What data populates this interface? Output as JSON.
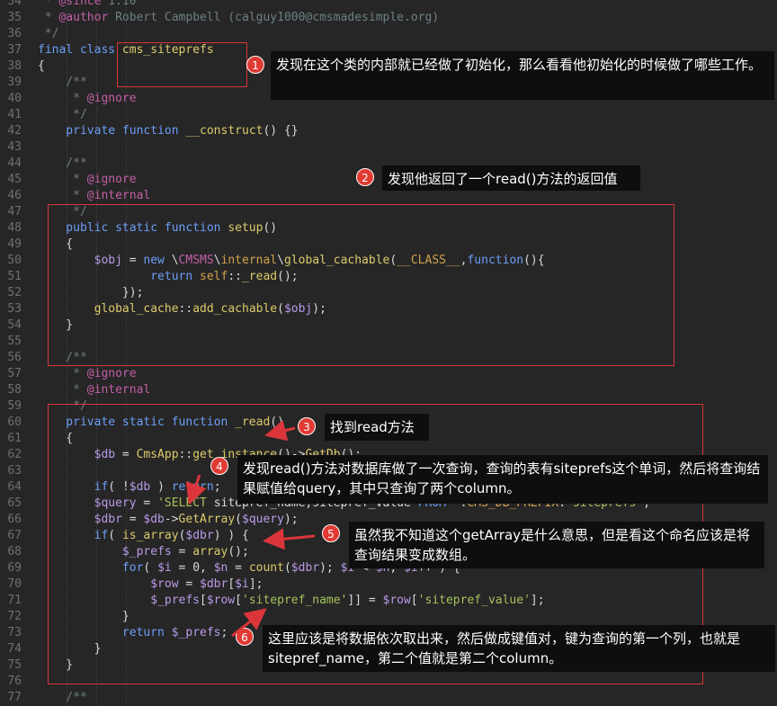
{
  "colors": {
    "annotation_red": "#d9353a",
    "badge_red": "#e03b33",
    "callout_bg": "#0e0e0e",
    "editor_bg": "#262626"
  },
  "code_lines": [
    {
      "n": "34",
      "t": [
        [
          "cm",
          " * "
        ],
        [
          "cmt",
          "@since"
        ],
        [
          "cm",
          " 1.10"
        ]
      ]
    },
    {
      "n": "35",
      "t": [
        [
          "cm",
          " * "
        ],
        [
          "cmt",
          "@author"
        ],
        [
          "cm",
          " Robert Campbell (calguy1000@cmsmadesimple.org)"
        ]
      ]
    },
    {
      "n": "36",
      "t": [
        [
          "cm",
          " */"
        ]
      ]
    },
    {
      "n": "37",
      "t": [
        [
          "kw",
          "final class "
        ],
        [
          "fn",
          "cms_siteprefs"
        ]
      ]
    },
    {
      "n": "38",
      "t": [
        [
          "pun",
          "{"
        ]
      ]
    },
    {
      "n": "39",
      "t": [
        [
          "cm",
          "    /**"
        ]
      ]
    },
    {
      "n": "40",
      "t": [
        [
          "cm",
          "     * "
        ],
        [
          "cmt",
          "@ignore"
        ]
      ]
    },
    {
      "n": "41",
      "t": [
        [
          "cm",
          "     */"
        ]
      ]
    },
    {
      "n": "42",
      "t": [
        [
          "kw",
          "    private function "
        ],
        [
          "fn",
          "__construct"
        ],
        [
          "pun",
          "() {}"
        ]
      ]
    },
    {
      "n": "43",
      "t": [
        [
          "pun",
          ""
        ]
      ]
    },
    {
      "n": "44",
      "t": [
        [
          "cm",
          "    /**"
        ]
      ]
    },
    {
      "n": "45",
      "t": [
        [
          "cm",
          "     * "
        ],
        [
          "cmt",
          "@ignore"
        ]
      ]
    },
    {
      "n": "46",
      "t": [
        [
          "cm",
          "     * "
        ],
        [
          "cmt",
          "@internal"
        ]
      ]
    },
    {
      "n": "47",
      "t": [
        [
          "cm",
          "     */"
        ]
      ]
    },
    {
      "n": "48",
      "t": [
        [
          "kw",
          "    public static function "
        ],
        [
          "fn",
          "setup"
        ],
        [
          "pun",
          "()"
        ]
      ]
    },
    {
      "n": "49",
      "t": [
        [
          "pun",
          "    {"
        ]
      ]
    },
    {
      "n": "50",
      "t": [
        [
          "var",
          "        $obj"
        ],
        [
          "pun",
          " = "
        ],
        [
          "kw",
          "new "
        ],
        [
          "pun",
          "\\"
        ],
        [
          "cmt",
          "CMSMS"
        ],
        [
          "pun",
          "\\"
        ],
        [
          "cls",
          "internal"
        ],
        [
          "pun",
          "\\"
        ],
        [
          "fn",
          "global_cachable"
        ],
        [
          "pun",
          "("
        ],
        [
          "cls",
          "__CLASS__"
        ],
        [
          "pun",
          ","
        ],
        [
          "kw",
          "function"
        ],
        [
          "pun",
          "(){"
        ]
      ]
    },
    {
      "n": "51",
      "t": [
        [
          "kw",
          "                return "
        ],
        [
          "cls",
          "self"
        ],
        [
          "pun",
          "::"
        ],
        [
          "fn",
          "_read"
        ],
        [
          "pun",
          "();"
        ]
      ]
    },
    {
      "n": "52",
      "t": [
        [
          "pun",
          "            });"
        ]
      ]
    },
    {
      "n": "53",
      "t": [
        [
          "fn",
          "        global_cache"
        ],
        [
          "pun",
          "::"
        ],
        [
          "fn",
          "add_cachable"
        ],
        [
          "pun",
          "("
        ],
        [
          "var",
          "$obj"
        ],
        [
          "pun",
          ");"
        ]
      ]
    },
    {
      "n": "54",
      "t": [
        [
          "pun",
          "    }"
        ]
      ]
    },
    {
      "n": "55",
      "t": [
        [
          "pun",
          ""
        ]
      ]
    },
    {
      "n": "56",
      "t": [
        [
          "cm",
          "    /**"
        ]
      ]
    },
    {
      "n": "57",
      "t": [
        [
          "cm",
          "     * "
        ],
        [
          "cmt",
          "@ignore"
        ]
      ]
    },
    {
      "n": "58",
      "t": [
        [
          "cm",
          "     * "
        ],
        [
          "cmt",
          "@internal"
        ]
      ]
    },
    {
      "n": "59",
      "t": [
        [
          "cm",
          "     */"
        ]
      ]
    },
    {
      "n": "60",
      "t": [
        [
          "kw",
          "    private static function "
        ],
        [
          "fn",
          "_read"
        ],
        [
          "pun",
          "()"
        ]
      ]
    },
    {
      "n": "61",
      "t": [
        [
          "pun",
          "    {"
        ]
      ]
    },
    {
      "n": "62",
      "t": [
        [
          "var",
          "        $db"
        ],
        [
          "pun",
          " = "
        ],
        [
          "fn",
          "CmsApp"
        ],
        [
          "pun",
          "::"
        ],
        [
          "fn",
          "get_instance"
        ],
        [
          "pun",
          "()->"
        ],
        [
          "fn",
          "GetDb"
        ],
        [
          "pun",
          "();"
        ]
      ]
    },
    {
      "n": "63",
      "t": [
        [
          "pun",
          ""
        ]
      ]
    },
    {
      "n": "64",
      "t": [
        [
          "kw",
          "        if"
        ],
        [
          "pun",
          "( !"
        ],
        [
          "var",
          "$db"
        ],
        [
          "pun",
          " ) "
        ],
        [
          "kw",
          "return"
        ],
        [
          "pun",
          ";"
        ]
      ]
    },
    {
      "n": "65",
      "t": [
        [
          "var",
          "        $query"
        ],
        [
          "pun",
          " = "
        ],
        [
          "str",
          "'SELECT "
        ],
        [
          "pun",
          "sitepref_name,sitepref_value "
        ],
        [
          "kw",
          "FROM "
        ],
        [
          "str",
          "'"
        ],
        [
          "pun",
          "."
        ],
        [
          "cls",
          "CMS_DB_PREFIX"
        ],
        [
          "pun",
          "."
        ],
        [
          "str",
          "'siteprefs'"
        ],
        [
          "pun",
          ";"
        ]
      ]
    },
    {
      "n": "66",
      "t": [
        [
          "var",
          "        $dbr"
        ],
        [
          "pun",
          " = "
        ],
        [
          "var",
          "$db"
        ],
        [
          "pun",
          "->"
        ],
        [
          "fn",
          "GetArray"
        ],
        [
          "pun",
          "("
        ],
        [
          "var",
          "$query"
        ],
        [
          "pun",
          ");"
        ]
      ]
    },
    {
      "n": "67",
      "t": [
        [
          "kw",
          "        if"
        ],
        [
          "pun",
          "( "
        ],
        [
          "fn",
          "is_array"
        ],
        [
          "pun",
          "("
        ],
        [
          "var",
          "$dbr"
        ],
        [
          "pun",
          ") ) {"
        ]
      ]
    },
    {
      "n": "68",
      "t": [
        [
          "var",
          "            $_prefs"
        ],
        [
          "pun",
          " = "
        ],
        [
          "fn",
          "array"
        ],
        [
          "pun",
          "();"
        ]
      ]
    },
    {
      "n": "69",
      "t": [
        [
          "kw",
          "            for"
        ],
        [
          "pun",
          "( "
        ],
        [
          "var",
          "$i"
        ],
        [
          "pun",
          " = 0, "
        ],
        [
          "var",
          "$n"
        ],
        [
          "pun",
          " = "
        ],
        [
          "fn",
          "count"
        ],
        [
          "pun",
          "("
        ],
        [
          "var",
          "$dbr"
        ],
        [
          "pun",
          "); "
        ],
        [
          "var",
          "$i"
        ],
        [
          "pun",
          " < "
        ],
        [
          "var",
          "$n"
        ],
        [
          "pun",
          "; "
        ],
        [
          "var",
          "$i"
        ],
        [
          "pun",
          "++ ) {"
        ]
      ]
    },
    {
      "n": "70",
      "t": [
        [
          "var",
          "                $row"
        ],
        [
          "pun",
          " = "
        ],
        [
          "var",
          "$dbr"
        ],
        [
          "pun",
          "["
        ],
        [
          "var",
          "$i"
        ],
        [
          "pun",
          "];"
        ]
      ]
    },
    {
      "n": "71",
      "t": [
        [
          "var",
          "                $_prefs"
        ],
        [
          "pun",
          "["
        ],
        [
          "var",
          "$row"
        ],
        [
          "pun",
          "["
        ],
        [
          "str",
          "'sitepref_name'"
        ],
        [
          "pun",
          "]] = "
        ],
        [
          "var",
          "$row"
        ],
        [
          "pun",
          "["
        ],
        [
          "str",
          "'sitepref_value'"
        ],
        [
          "pun",
          "];"
        ]
      ]
    },
    {
      "n": "72",
      "t": [
        [
          "pun",
          "            }"
        ]
      ]
    },
    {
      "n": "73",
      "t": [
        [
          "kw",
          "            return "
        ],
        [
          "var",
          "$_prefs"
        ],
        [
          "pun",
          ";"
        ]
      ]
    },
    {
      "n": "74",
      "t": [
        [
          "pun",
          "        }"
        ]
      ]
    },
    {
      "n": "75",
      "t": [
        [
          "pun",
          "    }"
        ]
      ]
    },
    {
      "n": "76",
      "t": [
        [
          "pun",
          ""
        ]
      ]
    },
    {
      "n": "77",
      "t": [
        [
          "cm",
          "    /**"
        ]
      ]
    }
  ],
  "annotations": [
    {
      "num": "1",
      "text": "发现在这个类的内部就已经做了初始化，那么看看他初始化的时候做了哪些工作。"
    },
    {
      "num": "2",
      "text": "发现他返回了一个read()方法的返回值"
    },
    {
      "num": "3",
      "text": "找到read方法"
    },
    {
      "num": "4",
      "text": "发现read()方法对数据库做了一次查询，查询的表有siteprefs这个单词，然后将查询结果赋值给query，其中只查询了两个column。"
    },
    {
      "num": "5",
      "text": "虽然我不知道这个getArray是什么意思，但是看这个命名应该是将查询结果变成数组。"
    },
    {
      "num": "6",
      "text": "这里应该是将数据依次取出来，然后做成键值对，键为查询的第一个列，也就是sitepref_name，第二个值就是第二个column。"
    }
  ]
}
